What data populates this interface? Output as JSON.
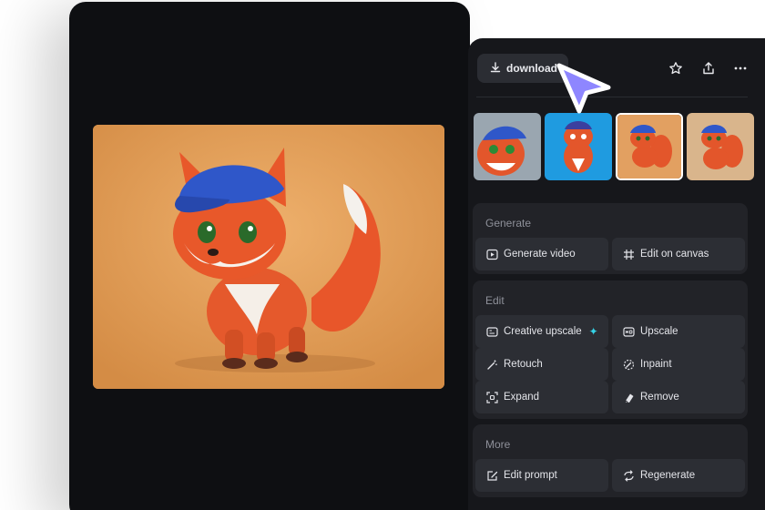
{
  "toolbar": {
    "download_label": "download",
    "icons": [
      "download-icon",
      "star-icon",
      "share-icon",
      "more-icon"
    ]
  },
  "thumbnails": [
    {
      "name": "fox-cartoon-closeup",
      "selected": false
    },
    {
      "name": "fox-sticker-blue-bg",
      "selected": false
    },
    {
      "name": "fox-3d-current",
      "selected": true
    },
    {
      "name": "fox-3d-variant",
      "selected": false
    }
  ],
  "sections": {
    "generate": {
      "title": "Generate",
      "actions": [
        "Generate video",
        "Edit on canvas"
      ]
    },
    "edit": {
      "title": "Edit",
      "actions": [
        "Creative upscale",
        "Upscale",
        "Retouch",
        "Inpaint",
        "Expand",
        "Remove"
      ]
    },
    "more": {
      "title": "More",
      "actions": [
        "Edit prompt",
        "Regenerate"
      ]
    }
  },
  "colors": {
    "accent_cursor": "#8e86ff",
    "sparkle": "#35d3e6",
    "panel_bg": "#16171b",
    "viewer_bg": "#0e0f12"
  }
}
